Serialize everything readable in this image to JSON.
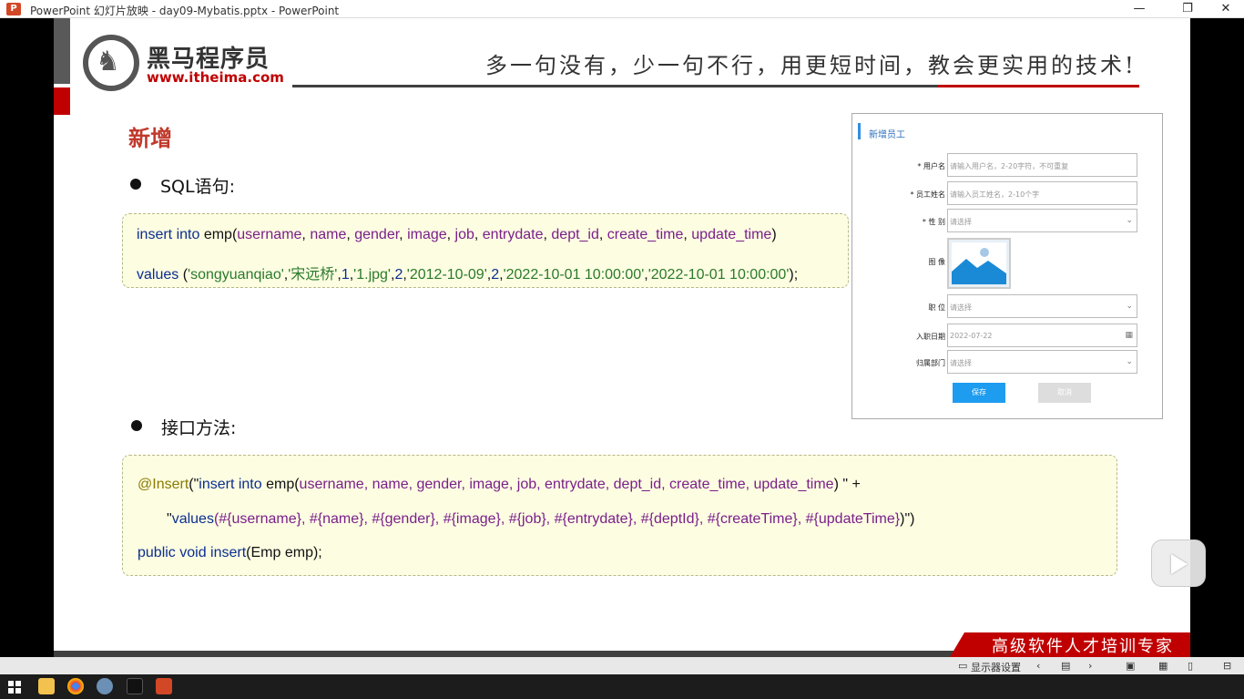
{
  "window": {
    "title": "PowerPoint 幻灯片放映  -  day09-Mybatis.pptx  -  PowerPoint",
    "app_icon": "P",
    "minimize": "—",
    "restore": "❐",
    "close": "✕"
  },
  "slide": {
    "logo": {
      "name": "黑马程序员",
      "url": "www.itheima.com"
    },
    "slogan": "多一句没有，少一句不行，用更短时间，教会更实用的技术!",
    "heading": "新增",
    "section1_label": "SQL语句:",
    "sql": {
      "line1": [
        {
          "t": "insert into ",
          "c": "kw"
        },
        {
          "t": "emp(",
          "c": "plain"
        },
        {
          "t": "username",
          "c": "fld"
        },
        {
          "t": ", ",
          "c": "plain"
        },
        {
          "t": "name",
          "c": "fld"
        },
        {
          "t": ", ",
          "c": "plain"
        },
        {
          "t": "gender",
          "c": "fld"
        },
        {
          "t": ", ",
          "c": "plain"
        },
        {
          "t": "image",
          "c": "fld"
        },
        {
          "t": ", ",
          "c": "plain"
        },
        {
          "t": "job",
          "c": "fld"
        },
        {
          "t": ", ",
          "c": "plain"
        },
        {
          "t": "entrydate",
          "c": "fld"
        },
        {
          "t": ", ",
          "c": "plain"
        },
        {
          "t": "dept_id",
          "c": "fld"
        },
        {
          "t": ", ",
          "c": "plain"
        },
        {
          "t": "create_time",
          "c": "fld"
        },
        {
          "t": ", ",
          "c": "plain"
        },
        {
          "t": "update_time",
          "c": "fld"
        },
        {
          "t": ")",
          "c": "plain"
        }
      ],
      "line2": [
        {
          "t": "values ",
          "c": "kw"
        },
        {
          "t": "(",
          "c": "plain"
        },
        {
          "t": "'songyuanqiao'",
          "c": "str"
        },
        {
          "t": ",",
          "c": "plain"
        },
        {
          "t": "'宋远桥'",
          "c": "str"
        },
        {
          "t": ",",
          "c": "plain"
        },
        {
          "t": "1",
          "c": "kw"
        },
        {
          "t": ",",
          "c": "plain"
        },
        {
          "t": "'1.jpg'",
          "c": "str"
        },
        {
          "t": ",",
          "c": "plain"
        },
        {
          "t": "2",
          "c": "kw"
        },
        {
          "t": ",",
          "c": "plain"
        },
        {
          "t": "'2012-10-09'",
          "c": "str"
        },
        {
          "t": ",",
          "c": "plain"
        },
        {
          "t": "2",
          "c": "kw"
        },
        {
          "t": ",",
          "c": "plain"
        },
        {
          "t": "'2022-10-01 10:00:00'",
          "c": "str"
        },
        {
          "t": ",",
          "c": "plain"
        },
        {
          "t": "'2022-10-01 10:00:00'",
          "c": "str"
        },
        {
          "t": ");",
          "c": "plain"
        }
      ]
    },
    "section2_label": "接口方法:",
    "iface": {
      "line1": [
        {
          "t": "@Insert",
          "c": "ann"
        },
        {
          "t": "(\"",
          "c": "plain"
        },
        {
          "t": "insert into ",
          "c": "kw"
        },
        {
          "t": "emp(",
          "c": "plain"
        },
        {
          "t": "username, name, gender, image, job, entrydate, dept_id, create_time, update_time",
          "c": "fld"
        },
        {
          "t": ") \" +",
          "c": "plain"
        }
      ],
      "line2": [
        {
          "t": "\"",
          "c": "plain"
        },
        {
          "t": "values",
          "c": "kw"
        },
        {
          "t": "(#{username}, #{name}, #{gender}, #{image}, #{job}, #{entrydate}, #{deptId}, #{createTime}, #{updateTime}",
          "c": "fld"
        },
        {
          "t": ")\")",
          "c": "plain"
        }
      ],
      "line3": [
        {
          "t": "public void ",
          "c": "kw"
        },
        {
          "t": "insert",
          "c": "kw"
        },
        {
          "t": "(Emp emp);",
          "c": "plain"
        }
      ]
    },
    "form": {
      "title": "新增员工",
      "username_label": "* 用户名",
      "username_placeholder": "请输入用户名，2-20字符，不可重复",
      "name_label": "* 员工姓名",
      "name_placeholder": "请输入员工姓名，2-10个字",
      "gender_label": "* 性    别",
      "gender_value": "请选择",
      "image_label": "图    像",
      "job_label": "职    位",
      "job_value": "请选择",
      "entry_label": "入职日期",
      "entry_value": "2022-07-22",
      "dept_label": "归属部门",
      "dept_value": "请选择",
      "save": "保存",
      "cancel": "取消",
      "chevron": "⌄",
      "calendar": "▦"
    },
    "banner": "高级软件人才培训专家"
  },
  "statusbar": {
    "display_settings": "显示器设置",
    "prev": "‹",
    "next": "›"
  },
  "colors": {
    "brand_red": "#c00000",
    "keyword": "#0b2e8f",
    "field": "#7a1f8a",
    "string": "#2a7a2a",
    "annotation": "#8a7a00",
    "code_bg": "#fdfde2",
    "form_button": "#1e9cf0"
  }
}
